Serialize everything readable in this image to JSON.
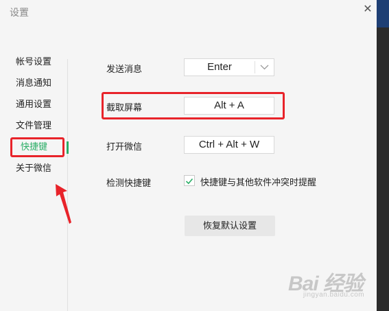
{
  "window": {
    "title": "设置",
    "close_glyph": "✕"
  },
  "sidebar": {
    "items": [
      {
        "label": "帐号设置",
        "active": false
      },
      {
        "label": "消息通知",
        "active": false
      },
      {
        "label": "通用设置",
        "active": false
      },
      {
        "label": "文件管理",
        "active": false
      },
      {
        "label": "快捷键",
        "active": true
      },
      {
        "label": "关于微信",
        "active": false
      }
    ]
  },
  "shortcuts": {
    "send_message": {
      "label": "发送消息",
      "value": "Enter",
      "chevron": "﹀"
    },
    "screen_capture": {
      "label": "截取屏幕",
      "value": "Alt + A"
    },
    "open_wechat": {
      "label": "打开微信",
      "value": "Ctrl + Alt + W"
    },
    "detect": {
      "label": "检测快捷键",
      "checkbox_checked": true,
      "checkbox_label": "快捷键与其他软件冲突时提醒"
    },
    "restore_button": "恢复默认设置"
  },
  "watermark": {
    "main": "Bai 经验",
    "sub": "jingyan.baidu.com"
  },
  "colors": {
    "accent_green": "#2aae67",
    "annotation_red": "#e8232a"
  }
}
